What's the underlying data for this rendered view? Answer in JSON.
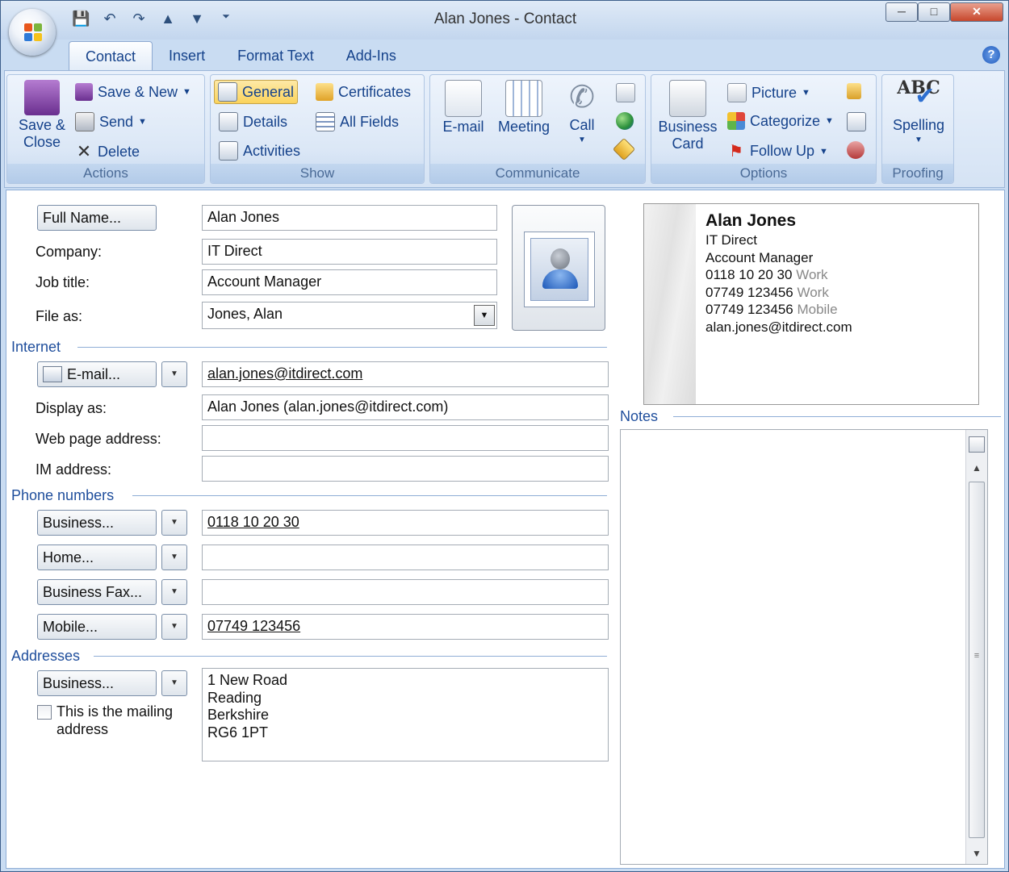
{
  "window": {
    "title": "Alan Jones  -  Contact",
    "controls": [
      "minimize",
      "maximize",
      "close"
    ]
  },
  "qat": {
    "icons": [
      "save-icon",
      "undo-icon",
      "redo-icon",
      "previous-item-icon",
      "next-item-icon",
      "customize-qat-icon"
    ]
  },
  "tabs": [
    {
      "label": "Contact",
      "active": true
    },
    {
      "label": "Insert"
    },
    {
      "label": "Format Text"
    },
    {
      "label": "Add-Ins"
    }
  ],
  "ribbon": {
    "actions": {
      "group": "Actions",
      "save_close": "Save &\nClose",
      "save_new": "Save & New",
      "send": "Send",
      "delete": "Delete"
    },
    "show": {
      "group": "Show",
      "general": "General",
      "details": "Details",
      "activities": "Activities",
      "certificates": "Certificates",
      "all_fields": "All Fields"
    },
    "communicate": {
      "group": "Communicate",
      "email": "E-mail",
      "meeting": "Meeting",
      "call": "Call"
    },
    "options": {
      "group": "Options",
      "business_card": "Business\nCard",
      "picture": "Picture",
      "categorize": "Categorize",
      "follow_up": "Follow Up"
    },
    "proofing": {
      "group": "Proofing",
      "spelling": "Spelling",
      "abc": "ABC"
    }
  },
  "form": {
    "full_name_btn": "Full Name...",
    "full_name": "Alan Jones",
    "company_label": "Company:",
    "company": "IT Direct",
    "job_title_label": "Job title:",
    "job_title": "Account Manager",
    "file_as_label": "File as:",
    "file_as": "Jones, Alan",
    "internet_section": "Internet",
    "email_btn": "E-mail...",
    "email": "alan.jones@itdirect.com",
    "display_as_label": "Display as:",
    "display_as": "Alan Jones (alan.jones@itdirect.com)",
    "web_label": "Web page address:",
    "web": "",
    "im_label": "IM address:",
    "im": "",
    "phone_section": "Phone numbers",
    "business_btn": "Business...",
    "business_phone": "0118 10 20 30",
    "home_btn": "Home...",
    "home_phone": "",
    "fax_btn": "Business Fax...",
    "fax": "",
    "mobile_btn": "Mobile...",
    "mobile": "07749 123456",
    "addresses_section": "Addresses",
    "address_btn": "Business...",
    "address": "1 New Road\nReading\nBerkshire\nRG6 1PT",
    "mailing_label": "This is the mailing\naddress",
    "mailing_checked": false,
    "notes_section": "Notes"
  },
  "card": {
    "name": "Alan Jones",
    "company": "IT Direct",
    "title": "Account Manager",
    "phone1": "0118 10 20 30",
    "phone1_type": "Work",
    "phone2": "07749 123456",
    "phone2_type": "Work",
    "phone3": "07749 123456",
    "phone3_type": "Mobile",
    "email": "alan.jones@itdirect.com"
  },
  "colors": {
    "ribbon_label": "#4a6a96",
    "tab_text": "#15428b",
    "section_text": "#1f4e9c",
    "selected_button": "#fbd35c"
  }
}
